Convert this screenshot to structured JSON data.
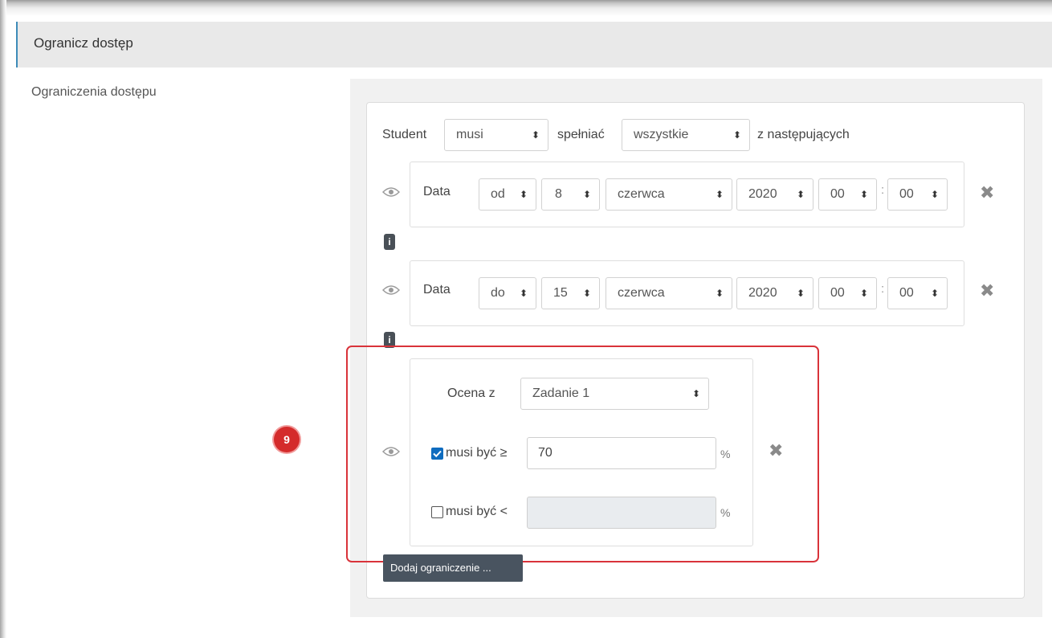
{
  "section": {
    "header": "Ogranicz dostęp",
    "field_label": "Ograniczenia dostępu"
  },
  "rule": {
    "subject": "Student",
    "must_select": "musi",
    "verb": "spełniać",
    "scope_select": "wszystkie",
    "suffix": "z następujących"
  },
  "conditions": [
    {
      "type_label": "Data",
      "direction": "od",
      "day": "8",
      "month": "czerwca",
      "year": "2020",
      "hour": "00",
      "minute": "00",
      "separator": ":"
    },
    {
      "type_label": "Data",
      "direction": "do",
      "day": "15",
      "month": "czerwca",
      "year": "2020",
      "hour": "00",
      "minute": "00",
      "separator": ":"
    }
  ],
  "grade_condition": {
    "label": "Ocena z",
    "activity": "Zadanie 1",
    "min_label": "musi być ≥",
    "min_checked": true,
    "min_value": "70",
    "max_label": "musi być <",
    "max_checked": false,
    "max_value": "",
    "unit": "%"
  },
  "icons": {
    "eye": "eye-icon",
    "remove": "✖",
    "info": "i",
    "select_arrows": "⬍"
  },
  "annotation": {
    "badge_number": "9",
    "color": "#d9333a"
  },
  "add_button_label": "Dodaj ograniczenie ...",
  "colors": {
    "accent": "#3d8bb8",
    "checkbox": "#0f6cbf",
    "button": "#495460"
  }
}
